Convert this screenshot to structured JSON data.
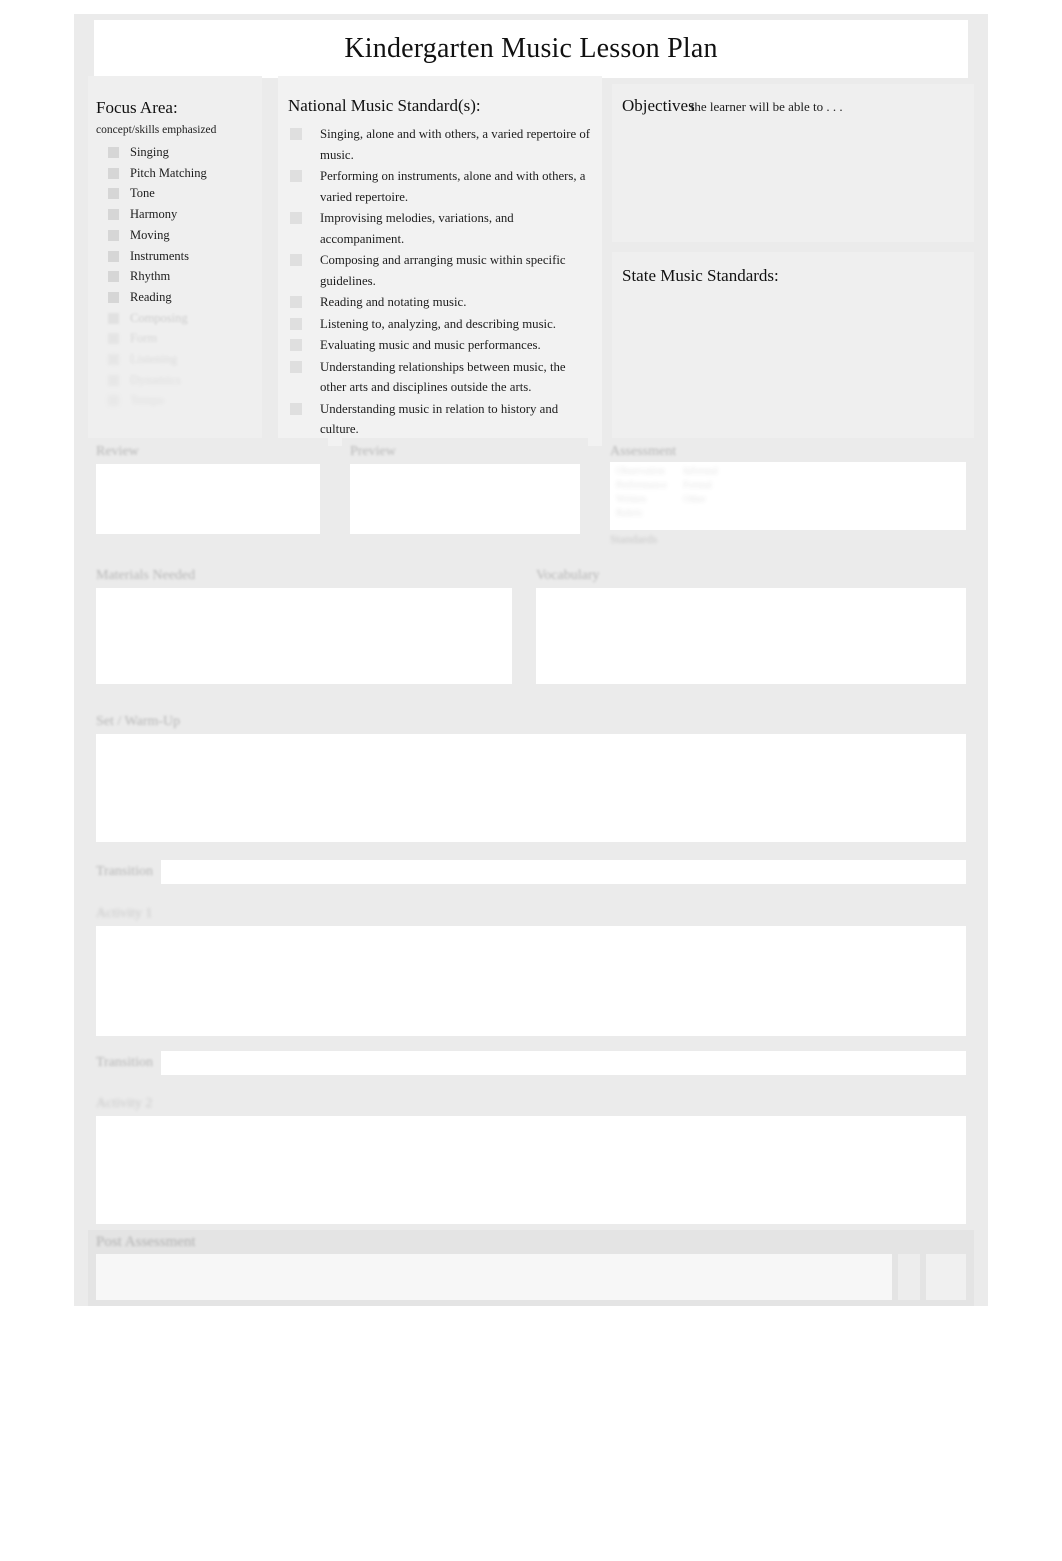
{
  "document": {
    "title": "Kindergarten Music Lesson Plan"
  },
  "focus_area": {
    "title": "Focus Area:",
    "subtitle": "concept/skills emphasized",
    "items": [
      "Singing",
      "Pitch Matching",
      "Tone",
      "Harmony",
      "Moving",
      "Instruments",
      "Rhythm",
      "Reading",
      "Composing",
      "Form",
      "Listening",
      "Dynamics",
      "Tempo"
    ]
  },
  "national_standards": {
    "title": "National Music Standard(s):",
    "items": [
      "Singing, alone and with others, a varied repertoire of music.",
      "Performing on instruments, alone and with others, a varied repertoire.",
      "Improvising melodies, variations, and accompaniment.",
      "Composing and arranging music within specific guidelines.",
      "Reading and notating music.",
      "Listening to, analyzing, and describing music.",
      "Evaluating music and music performances.",
      "Understanding relationships between music, the other arts and disciplines outside the arts.",
      "Understanding music in relation to history and culture."
    ]
  },
  "objectives": {
    "label": "Objectives",
    "hint": "the learner will be able to . . ."
  },
  "state_standards": {
    "title": "State Music Standards:"
  },
  "mid_row": {
    "review_label": "Review",
    "preview_label": "Preview",
    "assessment_label": "Assessment",
    "assessment_col1": [
      "Observation",
      "Performance",
      "Written",
      "Rubric"
    ],
    "assessment_col2": [
      "Informal",
      "Formal",
      "Other"
    ],
    "assessment_footer": "Standards"
  },
  "two_row": {
    "materials_label": "Materials Needed",
    "vocabulary_label": "Vocabulary"
  },
  "sections": {
    "set_label": "Set / Warm-Up",
    "transition_1_label": "Transition",
    "activity_1_label": "Activity 1",
    "transition_2_label": "Transition",
    "activity_2_label": "Activity 2"
  },
  "bottom": {
    "label": "Post Assessment"
  }
}
